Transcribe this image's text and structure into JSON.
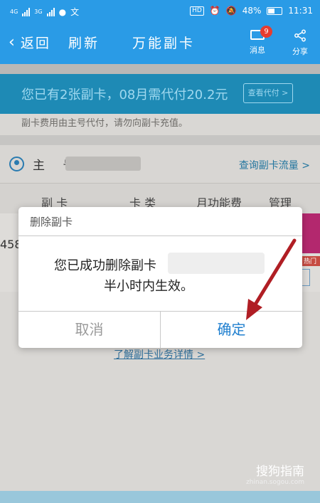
{
  "status_bar": {
    "network1": "4G",
    "network2": "3G",
    "battery_percent": "48%",
    "time": "11:31",
    "hd_label": "HD"
  },
  "title_bar": {
    "back_label": "返回",
    "refresh_label": "刷新",
    "title": "万能副卡",
    "message_label": "消息",
    "message_badge": "9",
    "share_label": "分享"
  },
  "banner": {
    "text": "您已有2张副卡，08月需代付20.2元",
    "button_label": "查看代付 >"
  },
  "note": "副卡费用由主号代付，请勿向副卡充值。",
  "main_number": {
    "label": "主 号",
    "query_link": "查询副卡流量 >"
  },
  "table": {
    "headers": [
      "副 卡",
      "卡 类",
      "月功能费",
      "管理"
    ],
    "row_partial_number": "458",
    "hot_tag": "热门"
  },
  "more_link": "了解副卡业务详情 >",
  "dialog": {
    "title": "删除副卡",
    "message_line1": "您已成功删除副卡",
    "message_line2": "半小时内生效。",
    "cancel_label": "取消",
    "ok_label": "确定"
  },
  "watermark": {
    "brand": "搜狗指南",
    "url": "zhinan.sogou.com"
  },
  "colors": {
    "primary": "#2a9be6",
    "banner": "#1e8ab5",
    "ok_button": "#1f7fcf",
    "arrow": "#b01e24",
    "badge": "#e73c2f"
  }
}
